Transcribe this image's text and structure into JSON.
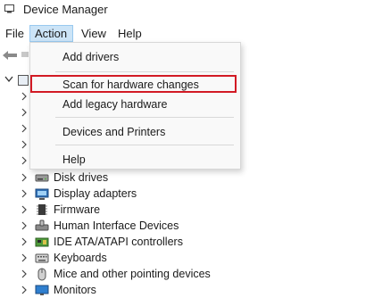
{
  "window": {
    "title": "Device Manager"
  },
  "menubar": {
    "items": [
      {
        "label": "File"
      },
      {
        "label": "Action"
      },
      {
        "label": "View"
      },
      {
        "label": "Help"
      }
    ],
    "active": "Action"
  },
  "action_menu": {
    "items": [
      {
        "label": "Add drivers"
      },
      {
        "label": "Scan for hardware changes",
        "highlighted": true
      },
      {
        "label": "Add legacy hardware"
      },
      {
        "label": "Devices and Printers"
      },
      {
        "label": "Help"
      }
    ],
    "highlight_color": "#d21a24"
  },
  "tree": {
    "devices": [
      {
        "label": "Disk drives",
        "icon": "disk-drive-icon"
      },
      {
        "label": "Display adapters",
        "icon": "display-adapter-icon"
      },
      {
        "label": "Firmware",
        "icon": "firmware-icon"
      },
      {
        "label": "Human Interface Devices",
        "icon": "hid-icon"
      },
      {
        "label": "IDE ATA/ATAPI controllers",
        "icon": "ide-controller-icon"
      },
      {
        "label": "Keyboards",
        "icon": "keyboard-icon"
      },
      {
        "label": "Mice and other pointing devices",
        "icon": "mouse-icon"
      },
      {
        "label": "Monitors",
        "icon": "monitor-icon"
      }
    ]
  },
  "colors": {
    "menu_active_bg": "#cce4f7",
    "menu_active_border": "#99c9ef",
    "dropdown_bg": "#f9f9f9"
  }
}
